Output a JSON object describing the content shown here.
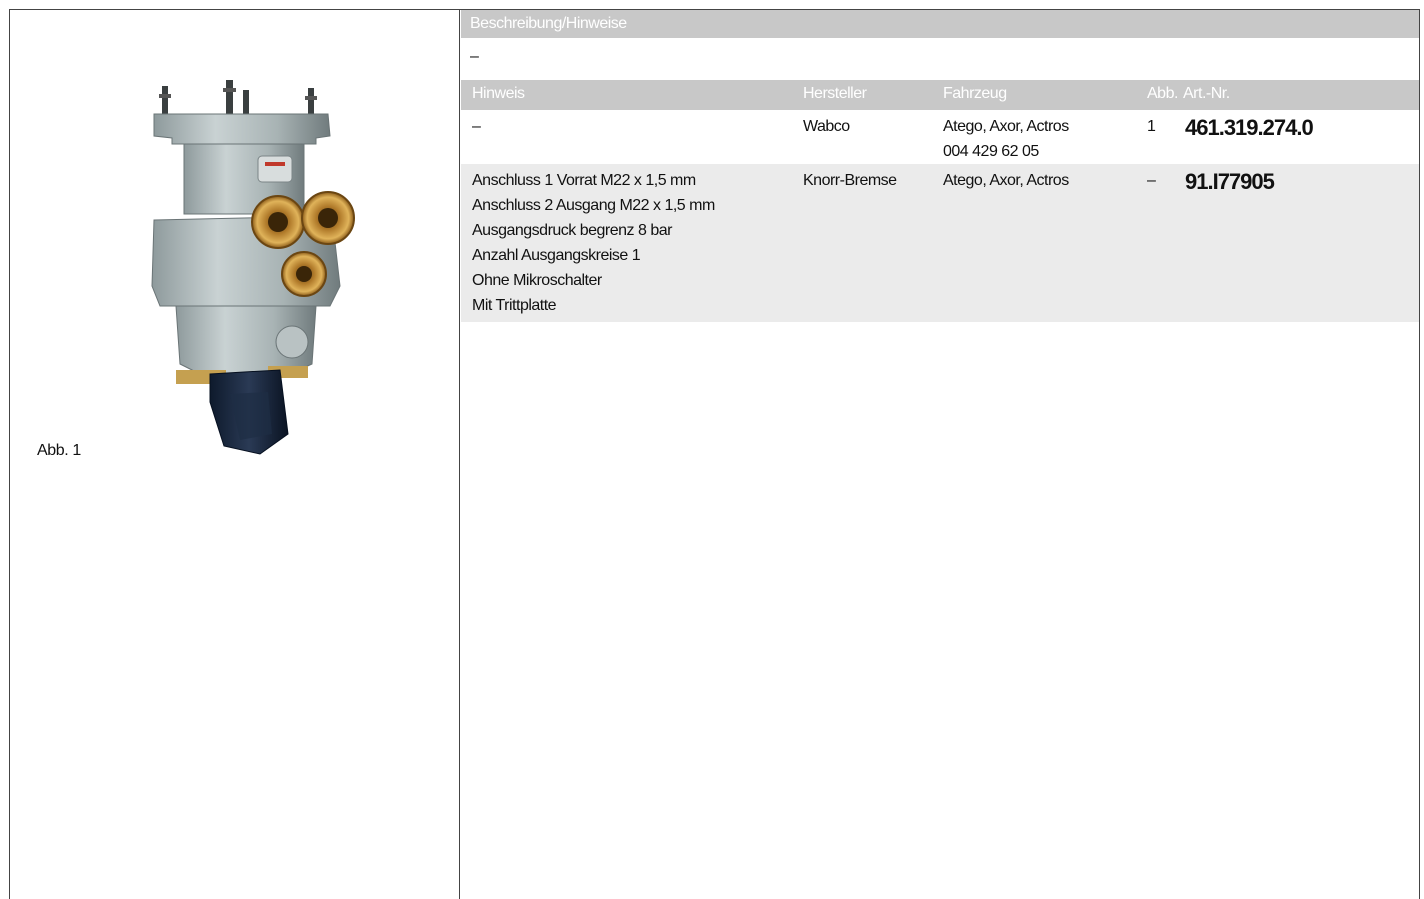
{
  "figure": {
    "caption": "Abb. 1",
    "image_icon": "foot-brake-valve-photo"
  },
  "description": {
    "header": "Beschreibung/Hinweise",
    "value": "–"
  },
  "table": {
    "headers": {
      "hinweis": "Hinweis",
      "hersteller": "Hersteller",
      "fahrzeug": "Fahrzeug",
      "abb": "Abb.",
      "artnr": "Art.-Nr."
    },
    "rows": [
      {
        "hinweis": [
          "–"
        ],
        "hersteller": "Wabco",
        "fahrzeug": [
          "Atego, Axor, Actros",
          "004 429 62 05"
        ],
        "abb": "1",
        "artnr": "461.319.274.0"
      },
      {
        "hinweis": [
          "Anschluss 1 Vorrat M22 x 1,5 mm",
          "Anschluss 2 Ausgang M22 x 1,5 mm",
          "Ausgangsdruck begrenz 8 bar",
          "Anzahl Ausgangskreise 1",
          "Ohne Mikroschalter",
          "Mit Trittplatte"
        ],
        "hersteller": "Knorr-Bremse",
        "fahrzeug": [
          "Atego, Axor, Actros"
        ],
        "abb": "–",
        "artnr": "91.I77905"
      }
    ]
  },
  "colors": {
    "header_band": "#c8c8c8",
    "alt_row": "#ebebeb",
    "border": "#444444"
  }
}
